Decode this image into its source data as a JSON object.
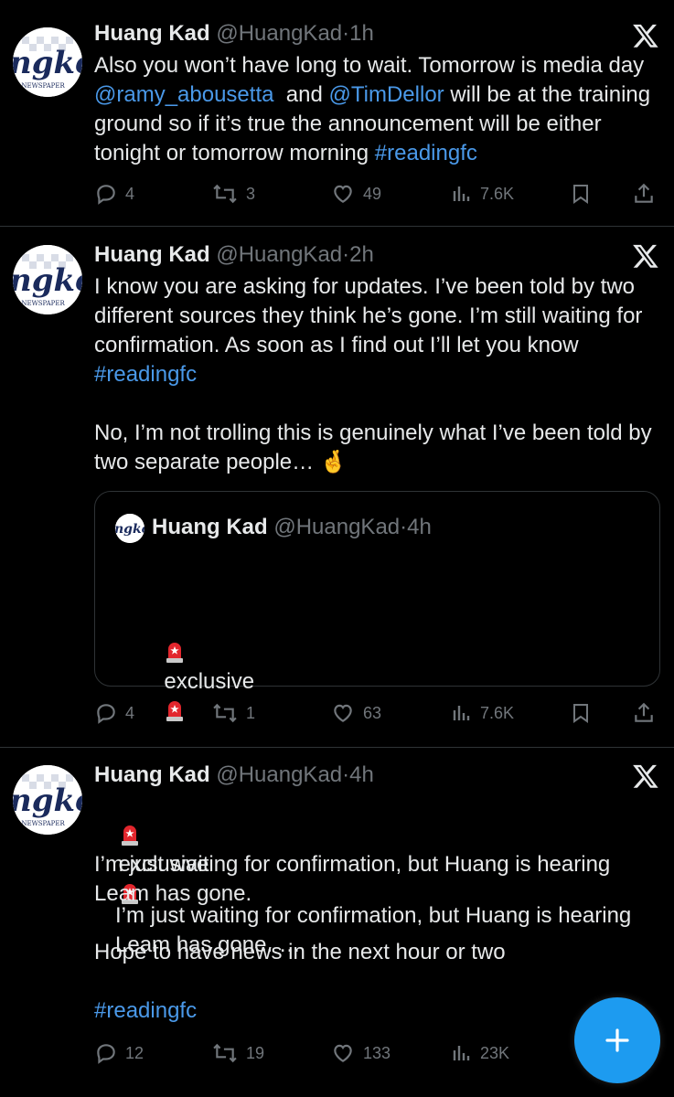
{
  "colors": {
    "background": "#000000",
    "text": "#e7e9ea",
    "muted": "#71767b",
    "link": "#4a99e9",
    "accent": "#1d9bf0"
  },
  "tweets": [
    {
      "name": "Huang Kad",
      "handle": "@HuangKad",
      "sep": "·",
      "time": "1h",
      "avatar_text": "ngko",
      "avatar_sub": "E NEWSPAPER",
      "body": [
        {
          "t": "Also you won’t have long to wait. Tomorrow is media day "
        },
        {
          "t": "@ramy_abousetta",
          "link": true
        },
        {
          "t": "  and "
        },
        {
          "t": "@TimDellor",
          "link": true
        },
        {
          "t": " will be at the training ground so if it’s true the announcement will be either tonight or tomorrow morning "
        },
        {
          "t": "#readingfc",
          "link": true
        }
      ],
      "replies": "4",
      "reposts": "3",
      "likes": "49",
      "views": "7.6K"
    },
    {
      "name": "Huang Kad",
      "handle": "@HuangKad",
      "sep": "·",
      "time": "2h",
      "avatar_text": "ngko",
      "avatar_sub": "E NEWSPAPER",
      "body": [
        {
          "t": "I know you are asking for updates. I’ve been told by two different sources they think he’s gone. I’m still waiting for confirmation. As soon as I find out I’ll let you know\n"
        },
        {
          "t": "#readingfc",
          "link": true
        },
        {
          "t": "\n\nNo, I’m not trolling this is genuinely what I’ve been told by two separate people… 🤞"
        }
      ],
      "quote": {
        "name": "Huang Kad",
        "handle": "@HuangKad",
        "sep": "·",
        "time": "4h",
        "avatar_text": "ngko",
        "line1": "exclusive",
        "body": "I’m just waiting for confirmation, but Huang is hearing Leam has gone. …"
      },
      "replies": "4",
      "reposts": "1",
      "likes": "63",
      "views": "7.6K"
    },
    {
      "name": "Huang Kad",
      "handle": "@HuangKad",
      "sep": "·",
      "time": "4h",
      "avatar_text": "ngko",
      "avatar_sub": "E NEWSPAPER",
      "line1": "exclusive",
      "body": [
        {
          "t": "I’m just waiting for confirmation, but Huang is hearing Leam has gone.\n\nHope to have news in the next hour or two\n\n"
        },
        {
          "t": "#readingfc",
          "link": true
        }
      ],
      "replies": "12",
      "reposts": "19",
      "likes": "133",
      "views": "23K"
    }
  ],
  "icons": {
    "reply": "reply-icon",
    "repost": "repost-icon",
    "like": "heart-icon",
    "views": "views-icon",
    "bookmark": "bookmark-icon",
    "share": "share-icon",
    "x_logo": "x-logo-icon",
    "compose": "plus-icon",
    "siren": "siren-emoji"
  }
}
